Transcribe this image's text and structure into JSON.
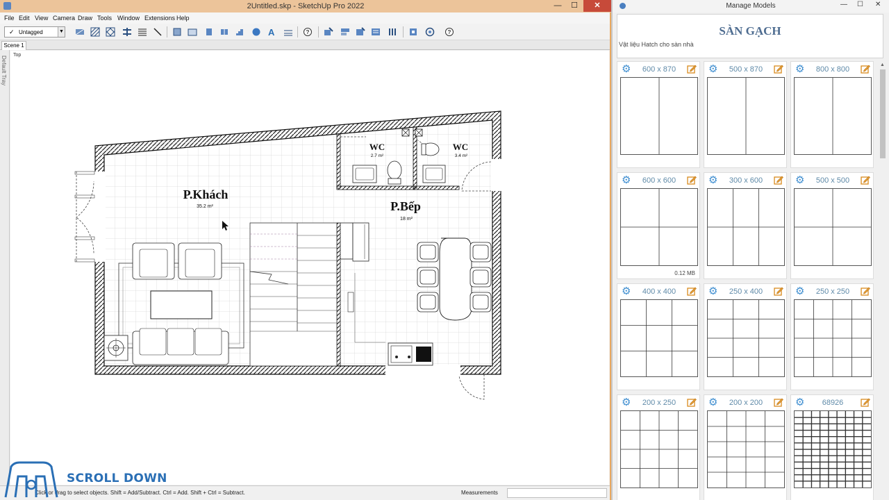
{
  "sketchup": {
    "title": "2Untitled.skp - SketchUp Pro 2022",
    "window_buttons": {
      "minimize": "—",
      "maximize": "☐",
      "close": "✕"
    },
    "menu": [
      "File",
      "Edit",
      "View",
      "Camera",
      "Draw",
      "Tools",
      "Window",
      "Extensions",
      "Help"
    ],
    "tag_selector": {
      "check": "✓",
      "value": "Untagged"
    },
    "scene_tab": "Scene 1",
    "tray_label": "Default Tray",
    "view_label": "Top",
    "rooms": [
      {
        "name": "P.Khách",
        "area": "35.2 m²"
      },
      {
        "name": "P.Bếp",
        "area": "18 m²"
      },
      {
        "name": "WC",
        "area": "2.7 m²"
      },
      {
        "name": "WC",
        "area": "3.4 m²"
      }
    ],
    "status_text": "Click or drag to select objects. Shift = Add/Subtract. Ctrl = Add. Shift + Ctrl = Subtract.",
    "measurements_label": "Measurements",
    "watermark_text": "SCROLL DOWN",
    "accent_color": "#e8a860"
  },
  "manage_models": {
    "title": "Manage Models",
    "window_buttons": {
      "minimize": "—",
      "maximize": "☐",
      "close": "✕"
    },
    "heading": "SÀN GẠCH",
    "subtitle": "Vật liệu Hatch cho sàn nhà",
    "items": [
      {
        "label": "600 x 870",
        "size": "",
        "cols": 2,
        "rows": 1
      },
      {
        "label": "500 x 870",
        "size": "",
        "cols": 2,
        "rows": 1
      },
      {
        "label": "800 x 800",
        "size": "",
        "cols": 2,
        "rows": 1
      },
      {
        "label": "600 x 600",
        "size": "0.12 MB",
        "cols": 2,
        "rows": 2
      },
      {
        "label": "300 x 600",
        "size": "",
        "cols": 3,
        "rows": 2
      },
      {
        "label": "500 x 500",
        "size": "",
        "cols": 2,
        "rows": 2
      },
      {
        "label": "400 x 400",
        "size": "",
        "cols": 3,
        "rows": 3
      },
      {
        "label": "250 x 400",
        "size": "",
        "cols": 3,
        "rows": 4
      },
      {
        "label": "250 x 250",
        "size": "",
        "cols": 4,
        "rows": 4
      },
      {
        "label": "200 x 250",
        "size": "",
        "cols": 4,
        "rows": 4
      },
      {
        "label": "200 x 200",
        "size": "",
        "cols": 4,
        "rows": 5
      },
      {
        "label": "68926",
        "size": "",
        "cols": 9,
        "rows": 12
      }
    ],
    "gear_color": "#3f8ed0",
    "heading_color": "#4f6d91"
  }
}
